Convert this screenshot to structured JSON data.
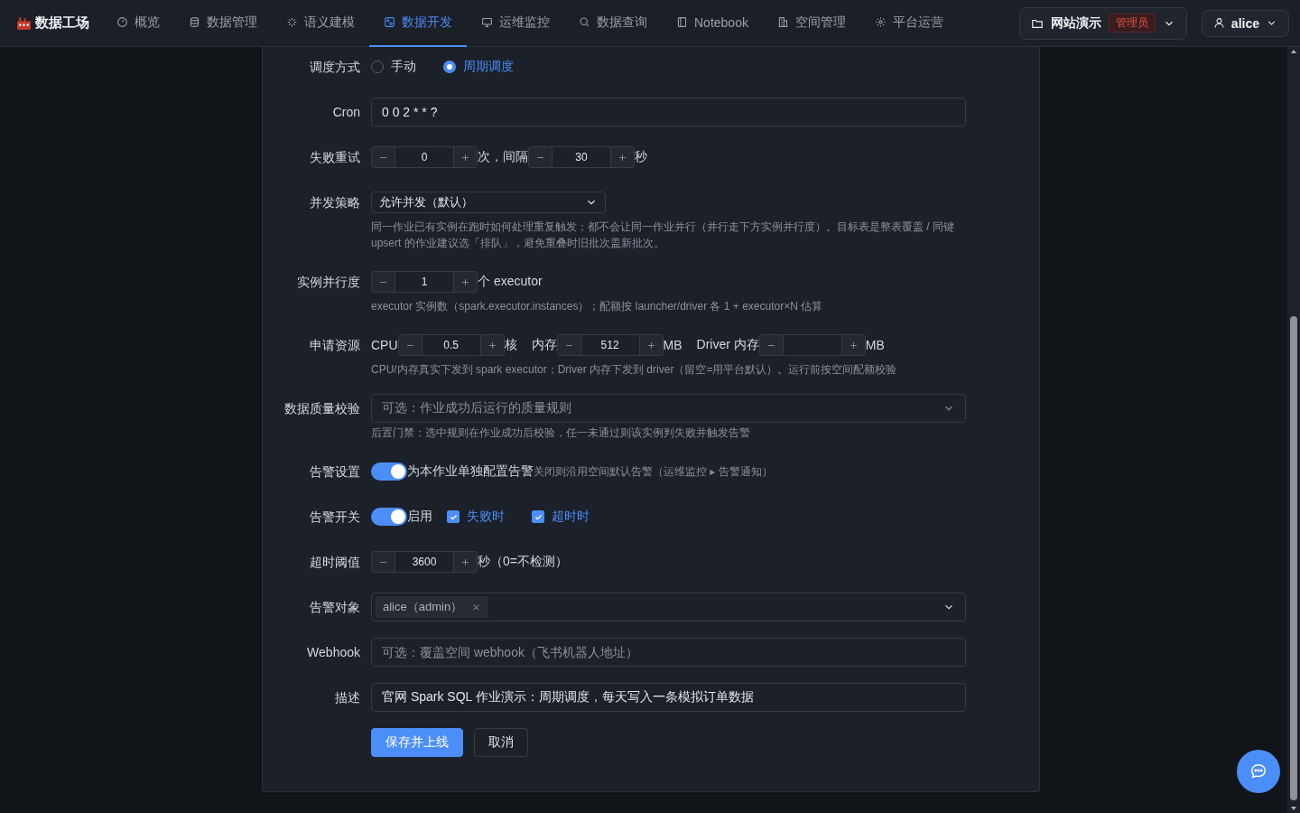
{
  "nav": {
    "brand": "数据工场",
    "items": [
      {
        "label": "概览",
        "selected": false
      },
      {
        "label": "数据管理",
        "selected": false
      },
      {
        "label": "语义建模",
        "selected": false
      },
      {
        "label": "数据开发",
        "selected": true
      },
      {
        "label": "运维监控",
        "selected": false
      },
      {
        "label": "数据查询",
        "selected": false
      },
      {
        "label": "Notebook",
        "selected": false
      },
      {
        "label": "空间管理",
        "selected": false
      },
      {
        "label": "平台运营",
        "selected": false
      }
    ],
    "workspace": {
      "name": "网站演示",
      "role": "管理员"
    },
    "user": {
      "name": "alice"
    }
  },
  "form": {
    "rows": [
      {
        "kind": "radio",
        "label": "调度方式",
        "options": [
          {
            "label": "手动",
            "selected": false
          },
          {
            "label": "周期调度",
            "selected": true
          }
        ]
      },
      {
        "kind": "input",
        "label": "Cron",
        "value": "0 0 2 * * ?"
      },
      {
        "kind": "inline",
        "label": "失败重试",
        "parts": [
          {
            "kind": "stepper",
            "value": "0"
          },
          {
            "kind": "text",
            "text": "次，间隔"
          },
          {
            "kind": "stepper",
            "value": "30"
          },
          {
            "kind": "text",
            "text": "秒"
          }
        ]
      },
      {
        "kind": "inline",
        "label": "并发策略",
        "parts": [
          {
            "kind": "select",
            "value": "允许并发（默认）"
          }
        ],
        "hint": "同一作业已有实例在跑时如何处理重复触发；都不会让同一作业并行（并行走下方实例并行度）。目标表是整表覆盖 / 同键 upsert 的作业建议选「排队」，避免重叠时旧批次盖新批次。"
      },
      {
        "kind": "inline",
        "label": "实例并行度",
        "parts": [
          {
            "kind": "stepper",
            "value": "1"
          },
          {
            "kind": "text",
            "text": "个 executor"
          }
        ],
        "hint": "executor 实例数（spark.executor.instances）；配额按 launcher/driver 各 1 + executor×N 估算"
      },
      {
        "kind": "inline",
        "label": "申请资源",
        "parts": [
          {
            "kind": "text",
            "text": "CPU"
          },
          {
            "kind": "stepper",
            "value": "0.5"
          },
          {
            "kind": "text",
            "text": "核"
          },
          {
            "kind": "gap"
          },
          {
            "kind": "text",
            "text": "内存"
          },
          {
            "kind": "stepper",
            "value": "512"
          },
          {
            "kind": "text",
            "text": "MB"
          },
          {
            "kind": "gap"
          },
          {
            "kind": "text",
            "text": "Driver 内存"
          },
          {
            "kind": "stepper"
          },
          {
            "kind": "text",
            "text": "MB"
          }
        ],
        "hint": "CPU/内存真实下发到 spark executor；Driver 内存下发到 driver（留空=用平台默认）。运行前按空间配额校验"
      },
      {
        "kind": "select",
        "label": "数据质量校验",
        "placeholder": "可选：作业成功后运行的质量规则",
        "hint": "后置门禁：选中规则在作业成功后校验，任一未通过则该实例判失败并触发告警"
      },
      {
        "kind": "inline",
        "label": "告警设置",
        "parts": [
          {
            "kind": "switch",
            "on": true
          },
          {
            "kind": "text",
            "text": "为本作业单独配置告警"
          },
          {
            "kind": "note",
            "text": "关闭则沿用空间默认告警（运维监控 ▸ 告警通知）"
          }
        ]
      },
      {
        "kind": "inline",
        "label": "告警开关",
        "parts": [
          {
            "kind": "switch",
            "on": true
          },
          {
            "kind": "text",
            "text": "启用"
          },
          {
            "kind": "checkbox",
            "label": "失败时",
            "checked": true
          },
          {
            "kind": "checkbox",
            "label": "超时时",
            "checked": true
          }
        ]
      },
      {
        "kind": "inline",
        "label": "超时阈值",
        "parts": [
          {
            "kind": "stepper",
            "value": "3600"
          },
          {
            "kind": "text",
            "text": "秒（0=不检测）"
          }
        ]
      },
      {
        "kind": "tags",
        "label": "告警对象",
        "tags": [
          "alice（admin）"
        ]
      },
      {
        "kind": "input",
        "label": "Webhook",
        "placeholder": "可选：覆盖空间 webhook（飞书机器人地址）"
      },
      {
        "kind": "input",
        "label": "描述",
        "value": "官网 Spark SQL 作业演示：周期调度，每天写入一条模拟订单数据"
      },
      {
        "kind": "actions",
        "buttons": [
          {
            "label": "保存并上线",
            "kind": "primary"
          },
          {
            "label": "取消",
            "kind": "default"
          }
        ]
      }
    ]
  }
}
